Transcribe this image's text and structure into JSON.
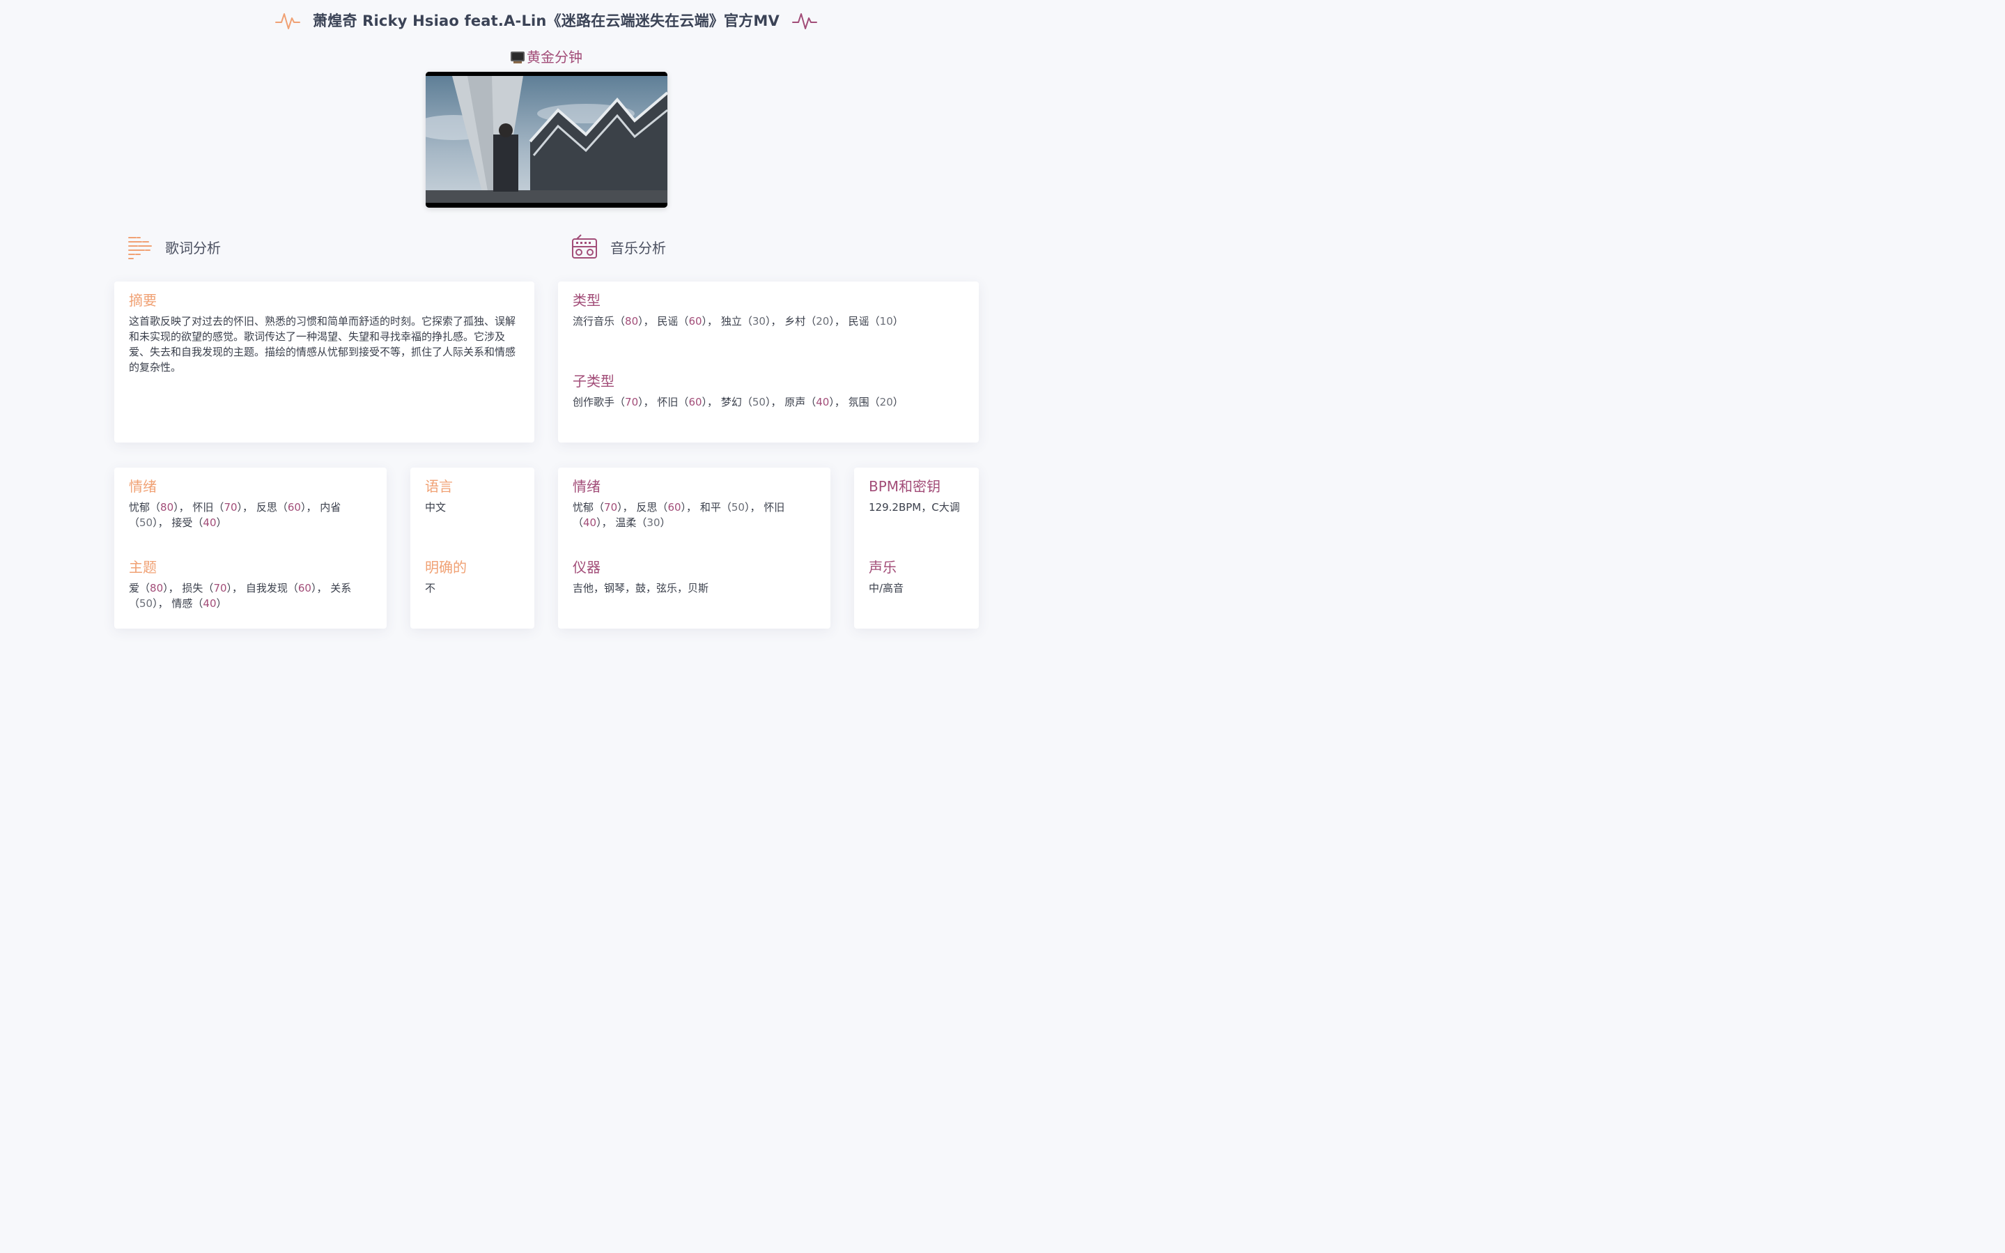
{
  "header": {
    "title": "萧煌奇 Ricky Hsiao feat.A-Lin《迷路在云端迷失在云端》官方MV",
    "subtitle": "黄金分钟"
  },
  "colors": {
    "accent_orange": "#f0a174",
    "accent_purple": "#a24d78",
    "text": "#3a3f4b"
  },
  "lyrics_section": {
    "label": "歌词分析",
    "icon": "lyrics-lines-icon"
  },
  "music_section": {
    "label": "音乐分析",
    "icon": "radio-icon"
  },
  "summary": {
    "heading": "摘要",
    "text": "这首歌反映了对过去的怀旧、熟悉的习惯和简单而舒适的时刻。它探索了孤独、误解和未实现的欲望的感觉。歌词传达了一种渴望、失望和寻找幸福的挣扎感。它涉及爱、失去和自我发现的主题。描绘的情感从忧郁到接受不等，抓住了人际关系和情感的复杂性。"
  },
  "genre": {
    "heading": "类型",
    "items": [
      {
        "name": "流行音乐",
        "score": "80"
      },
      {
        "name": "民谣",
        "score": "60"
      },
      {
        "name": "独立",
        "score": "30"
      },
      {
        "name": "乡村",
        "score": "20"
      },
      {
        "name": "民谣",
        "score": "10"
      }
    ]
  },
  "subgenre": {
    "heading": "子类型",
    "items": [
      {
        "name": "创作歌手",
        "score": "70"
      },
      {
        "name": "怀旧",
        "score": "60"
      },
      {
        "name": "梦幻",
        "score": "50"
      },
      {
        "name": "原声",
        "score": "40"
      },
      {
        "name": "氛围",
        "score": "20"
      }
    ]
  },
  "lyric_mood": {
    "heading": "情绪",
    "items": [
      {
        "name": "忧郁",
        "score": "80"
      },
      {
        "name": "怀旧",
        "score": "70"
      },
      {
        "name": "反思",
        "score": "60"
      },
      {
        "name": "内省",
        "score": "50"
      },
      {
        "name": "接受",
        "score": "40"
      }
    ]
  },
  "theme": {
    "heading": "主题",
    "items": [
      {
        "name": "爱",
        "score": "80"
      },
      {
        "name": "损失",
        "score": "70"
      },
      {
        "name": "自我发现",
        "score": "60"
      },
      {
        "name": "关系",
        "score": "50"
      },
      {
        "name": "情感",
        "score": "40"
      }
    ]
  },
  "language": {
    "heading": "语言",
    "value": "中文"
  },
  "explicit": {
    "heading": "明确的",
    "value": "不"
  },
  "music_mood": {
    "heading": "情绪",
    "items": [
      {
        "name": "忧郁",
        "score": "70"
      },
      {
        "name": "反思",
        "score": "60"
      },
      {
        "name": "和平",
        "score": "50"
      },
      {
        "name": "怀旧",
        "score": "40"
      },
      {
        "name": "温柔",
        "score": "30"
      }
    ]
  },
  "instruments": {
    "heading": "仪器",
    "value": "吉他，钢琴，鼓，弦乐，贝斯"
  },
  "bpm_key": {
    "heading": "BPM和密钥",
    "value": "129.2BPM，C大调"
  },
  "vocals": {
    "heading": "声乐",
    "value": "中/高音"
  }
}
